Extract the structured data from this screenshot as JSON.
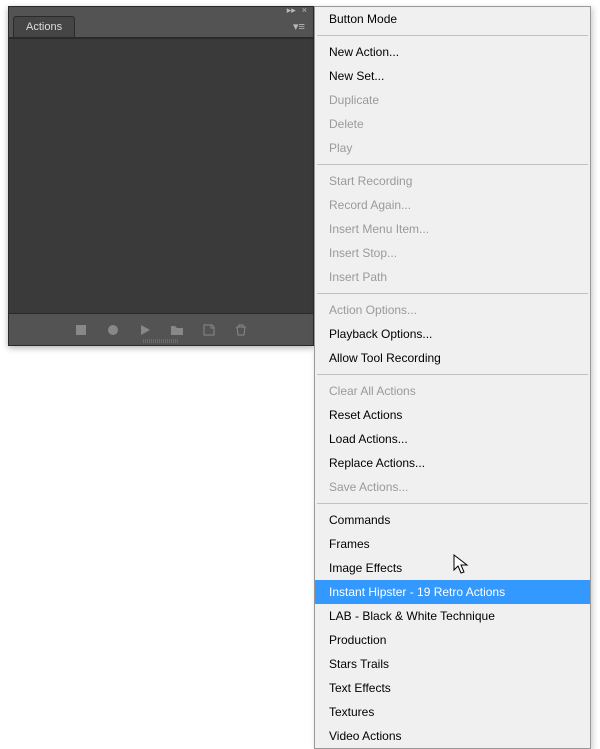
{
  "panel": {
    "tab_label": "Actions",
    "collapse_glyph": "▸▸",
    "close_glyph": "×",
    "flyout_glyph": "▾≡"
  },
  "menu": {
    "groups": [
      [
        {
          "label": "Button Mode",
          "disabled": false
        }
      ],
      [
        {
          "label": "New Action...",
          "disabled": false
        },
        {
          "label": "New Set...",
          "disabled": false
        },
        {
          "label": "Duplicate",
          "disabled": true
        },
        {
          "label": "Delete",
          "disabled": true
        },
        {
          "label": "Play",
          "disabled": true
        }
      ],
      [
        {
          "label": "Start Recording",
          "disabled": true
        },
        {
          "label": "Record Again...",
          "disabled": true
        },
        {
          "label": "Insert Menu Item...",
          "disabled": true
        },
        {
          "label": "Insert Stop...",
          "disabled": true
        },
        {
          "label": "Insert Path",
          "disabled": true
        }
      ],
      [
        {
          "label": "Action Options...",
          "disabled": true
        },
        {
          "label": "Playback Options...",
          "disabled": false
        },
        {
          "label": "Allow Tool Recording",
          "disabled": false
        }
      ],
      [
        {
          "label": "Clear All Actions",
          "disabled": true
        },
        {
          "label": "Reset Actions",
          "disabled": false
        },
        {
          "label": "Load Actions...",
          "disabled": false
        },
        {
          "label": "Replace Actions...",
          "disabled": false
        },
        {
          "label": "Save Actions...",
          "disabled": true
        }
      ],
      [
        {
          "label": "Commands",
          "disabled": false
        },
        {
          "label": "Frames",
          "disabled": false
        },
        {
          "label": "Image Effects",
          "disabled": false
        },
        {
          "label": "Instant Hipster - 19 Retro Actions",
          "disabled": false,
          "highlighted": true
        },
        {
          "label": "LAB - Black & White Technique",
          "disabled": false
        },
        {
          "label": "Production",
          "disabled": false
        },
        {
          "label": "Stars Trails",
          "disabled": false
        },
        {
          "label": "Text Effects",
          "disabled": false
        },
        {
          "label": "Textures",
          "disabled": false
        },
        {
          "label": "Video Actions",
          "disabled": false
        }
      ]
    ]
  }
}
